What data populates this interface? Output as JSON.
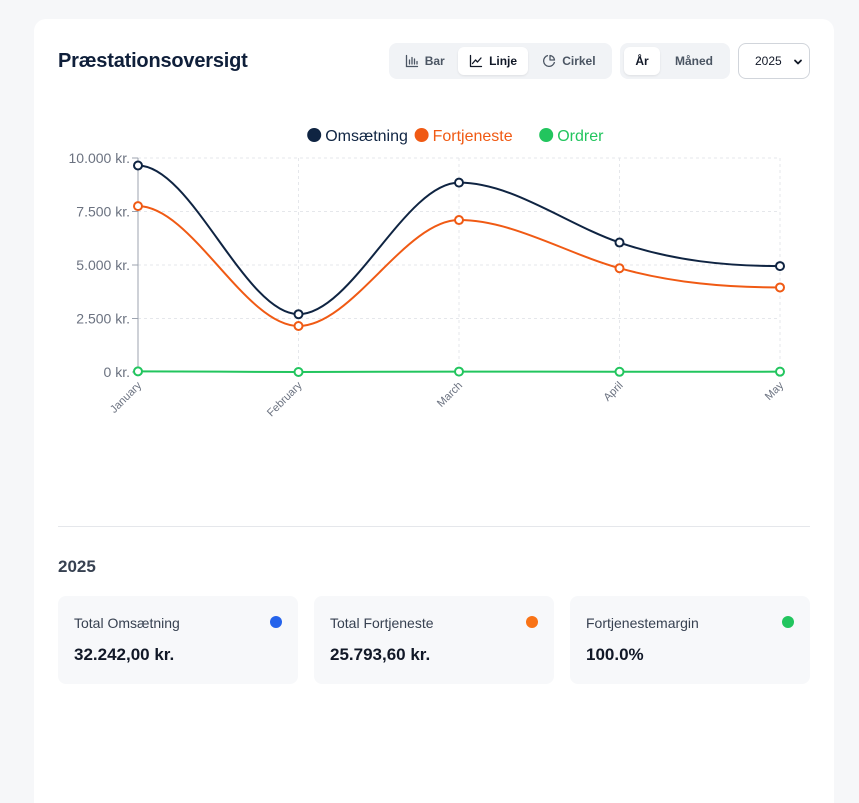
{
  "header": {
    "title": "Præstationsoversigt",
    "chart_types": [
      {
        "label": "Bar",
        "icon": "bar-chart-icon",
        "active": false
      },
      {
        "label": "Linje",
        "icon": "line-chart-icon",
        "active": true
      },
      {
        "label": "Cirkel",
        "icon": "pie-chart-icon",
        "active": false
      }
    ],
    "periods": [
      {
        "label": "År",
        "active": true
      },
      {
        "label": "Måned",
        "active": false
      }
    ],
    "year_select": {
      "value": "2025",
      "icon": "chevron-down-icon"
    }
  },
  "chart_data": {
    "type": "line",
    "x": [
      "January",
      "February",
      "March",
      "April",
      "May"
    ],
    "series": [
      {
        "name": "Omsætning",
        "color": "#0f2442",
        "values": [
          9650,
          2700,
          8850,
          6050,
          4950
        ]
      },
      {
        "name": "Fortjeneste",
        "color": "#f05a14",
        "values": [
          7750,
          2150,
          7100,
          4850,
          3950
        ]
      },
      {
        "name": "Ordrer",
        "color": "#22c55e",
        "values": [
          30,
          0,
          20,
          10,
          15
        ]
      }
    ],
    "yticks": [
      "10.000 kr.",
      "7.500 kr.",
      "5.000 kr.",
      "2.500 kr.",
      "0 kr."
    ],
    "ytick_values": [
      10000,
      7500,
      5000,
      2500,
      0
    ],
    "ylim": [
      0,
      10000
    ],
    "grid": true,
    "legend_position": "top-center",
    "smooth": true
  },
  "summary": {
    "year": "2025",
    "cards": [
      {
        "label": "Total Omsætning",
        "value": "32.242,00 kr.",
        "color": "#2563eb"
      },
      {
        "label": "Total Fortjeneste",
        "value": "25.793,60 kr.",
        "color": "#f97316"
      },
      {
        "label": "Fortjenestemargin",
        "value": "100.0%",
        "color": "#22c55e"
      }
    ]
  }
}
